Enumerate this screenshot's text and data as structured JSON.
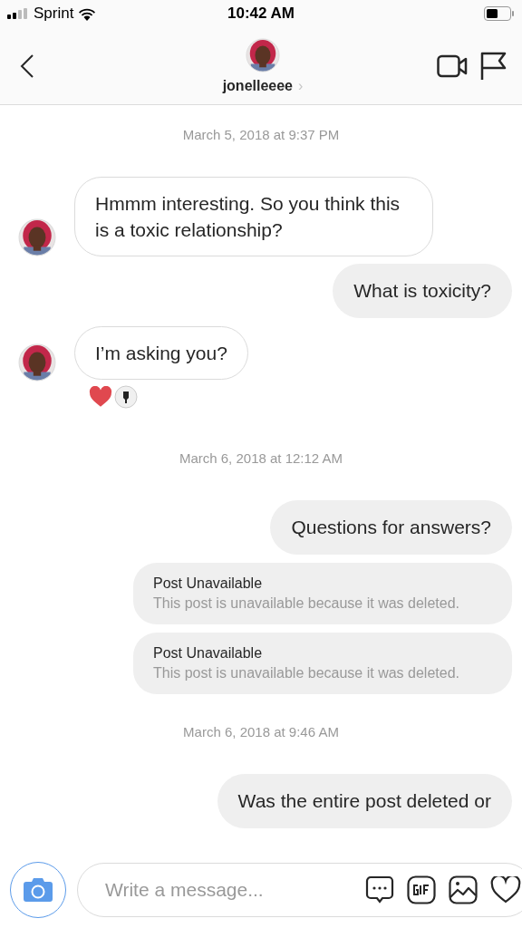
{
  "status_bar": {
    "carrier": "Sprint",
    "time": "10:42 AM"
  },
  "header": {
    "username": "jonelleeee",
    "chevron": "›"
  },
  "messages": [
    {
      "kind": "timestamp",
      "text": "March 5, 2018 at 9:37 PM"
    },
    {
      "kind": "incoming",
      "text": "Hmmm interesting. So you think this is a toxic relationship?",
      "reacted": false
    },
    {
      "kind": "outgoing",
      "text": "What is toxicity?"
    },
    {
      "kind": "incoming",
      "text": "I’m asking you?",
      "reacted": true
    },
    {
      "kind": "timestamp",
      "text": "March 6, 2018 at 12:12 AM"
    },
    {
      "kind": "outgoing",
      "text": "Questions for answers?"
    },
    {
      "kind": "post",
      "title": "Post Unavailable",
      "text": "This post is unavailable because it was deleted."
    },
    {
      "kind": "post",
      "title": "Post Unavailable",
      "text": "This post is unavailable because it was deleted."
    },
    {
      "kind": "timestamp",
      "text": "March 6, 2018 at 9:46 AM"
    },
    {
      "kind": "outgoing",
      "text": "Was the entire post deleted or"
    }
  ],
  "composer": {
    "placeholder": "Write a message..."
  }
}
